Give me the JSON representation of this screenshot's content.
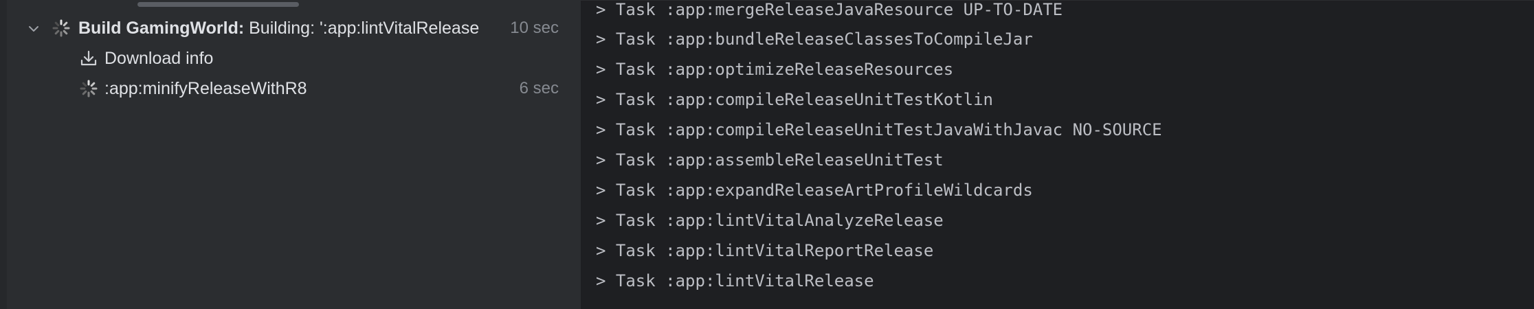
{
  "tree": {
    "build": {
      "bold_label": "Build GamingWorld:",
      "status": " Building: ':app:lintVitalRelease",
      "time": "10 sec"
    },
    "download": {
      "label": "Download info"
    },
    "minify": {
      "label": ":app:minifyReleaseWithR8",
      "time": "6 sec"
    }
  },
  "console": {
    "lines": [
      "> Task :app:mergeReleaseJavaResource UP-TO-DATE",
      "> Task :app:bundleReleaseClassesToCompileJar",
      "> Task :app:optimizeReleaseResources",
      "> Task :app:compileReleaseUnitTestKotlin",
      "> Task :app:compileReleaseUnitTestJavaWithJavac NO-SOURCE",
      "> Task :app:assembleReleaseUnitTest",
      "> Task :app:expandReleaseArtProfileWildcards",
      "> Task :app:lintVitalAnalyzeRelease",
      "> Task :app:lintVitalReportRelease",
      "> Task :app:lintVitalRelease"
    ]
  },
  "icons": {
    "chevron": "chevron-down-icon",
    "spinner": "spinner-icon",
    "download": "download-icon"
  },
  "colors": {
    "panel_bg": "#2b2d30",
    "console_bg": "#1e1f22",
    "text": "#dfe1e5",
    "muted": "#868a91",
    "console_text": "#bcbec4"
  }
}
